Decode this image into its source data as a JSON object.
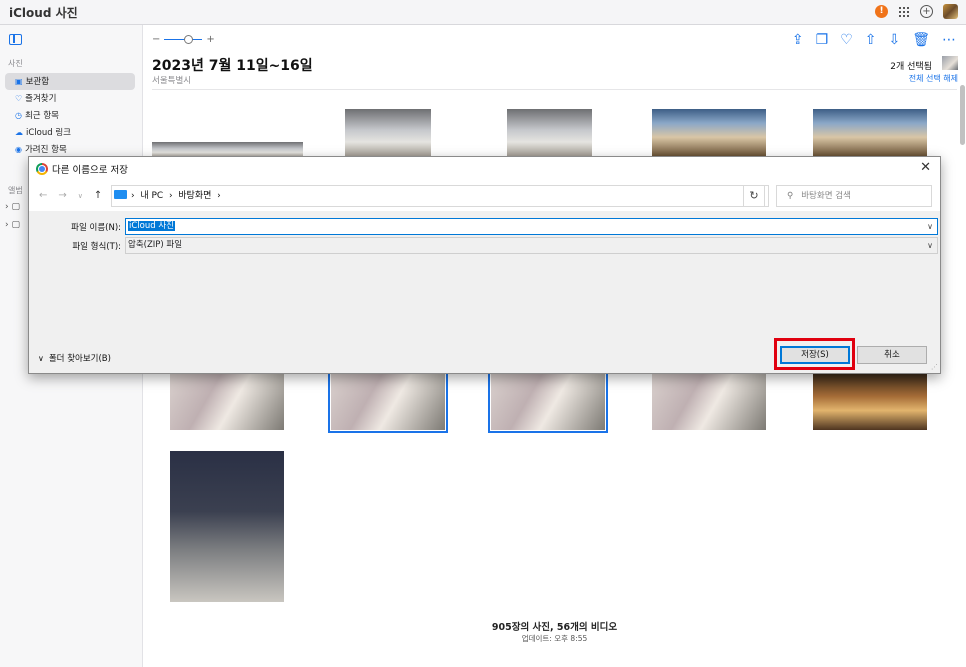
{
  "app": {
    "title": "iCloud 사진"
  },
  "topbar": {
    "alert_badge": "!",
    "icons": [
      "apple-icon",
      "alert-icon",
      "apps-grid-icon",
      "add-circle-icon",
      "avatar"
    ]
  },
  "sidebar": {
    "section_photos": "사진",
    "items": [
      {
        "label": "보관함",
        "icon": "library-icon",
        "active": true
      },
      {
        "label": "즐겨찾기",
        "icon": "heart-icon"
      },
      {
        "label": "최근 항목",
        "icon": "clock-icon"
      },
      {
        "label": "iCloud 링크",
        "icon": "cloud-link-icon"
      },
      {
        "label": "가려진 항목",
        "icon": "eye-icon"
      }
    ],
    "section_albums": "앨범"
  },
  "main": {
    "zoom_minus": "−",
    "zoom_plus": "+",
    "title": "2023년 7월 11일~16일",
    "subtitle": "서울특별시",
    "selected_count": "2개 선택됨",
    "deselect_all": "전체 선택 해제",
    "footer_count": "905장의 사진, 56개의 비디오",
    "footer_updated": "업데이트: 오후 8:55"
  },
  "dialog": {
    "title": "다른 이름으로 저장",
    "close": "✕",
    "path_pc": "내 PC",
    "path_sep": "›",
    "path_desktop": "바탕화면",
    "search_placeholder": "바탕화면 검색",
    "filename_label": "파일 이름(N):",
    "filename_value": "iCloud 사진",
    "filetype_label": "파일 형식(T):",
    "filetype_value": "압축(ZIP) 파일",
    "browse_label": "폴더 찾아보기(B)",
    "save_label": "저장(S)",
    "cancel_label": "취소"
  },
  "colors": {
    "accent": "#1a73e8",
    "highlight": "#e0000f",
    "alert": "#f0731a"
  }
}
